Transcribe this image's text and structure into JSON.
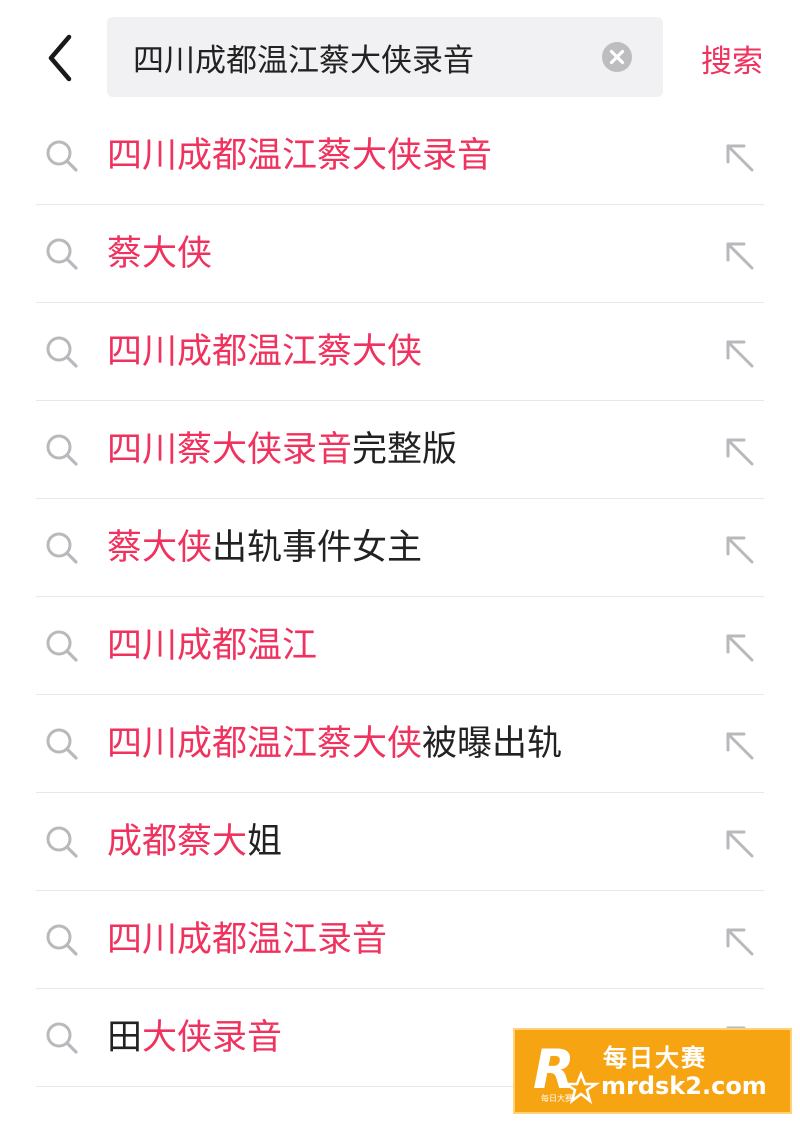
{
  "search": {
    "query": "四川成都温江蔡大侠录音",
    "button_label": "搜索"
  },
  "suggestions": [
    {
      "highlight": "四川成都温江蔡大侠录音",
      "rest": ""
    },
    {
      "highlight": "蔡大侠",
      "rest": ""
    },
    {
      "highlight": "四川成都温江蔡大侠",
      "rest": ""
    },
    {
      "highlight": "四川蔡大侠录音",
      "rest": "完整版"
    },
    {
      "highlight": "蔡大侠",
      "rest": "出轨事件女主"
    },
    {
      "highlight": "四川成都温江",
      "rest": ""
    },
    {
      "highlight": "四川成都温江蔡大侠",
      "rest": "被曝出轨"
    },
    {
      "highlight": "成都蔡大",
      "rest": "姐"
    },
    {
      "highlight": "四川成都温江录音",
      "rest": ""
    },
    {
      "prefix": "田",
      "highlight": "大侠录音",
      "rest": ""
    }
  ],
  "icons": {
    "back": "chevron-left-icon",
    "clear": "clear-circle-icon",
    "row_search": "search-icon",
    "row_fill": "arrow-up-left-icon"
  },
  "colors": {
    "highlight": "#f0325e",
    "text": "#222222",
    "icon_gray": "#b9b9bd",
    "searchbox_bg": "#f1f1f3"
  },
  "watermark": {
    "logo_text": "R 每日大赛",
    "title": "每日大赛",
    "url": "mrdsk2.com"
  }
}
